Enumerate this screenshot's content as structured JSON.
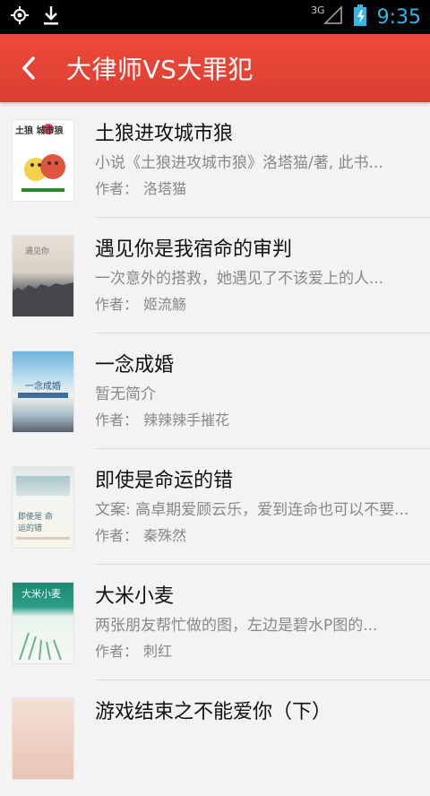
{
  "status": {
    "time": "9:35",
    "network": "3G"
  },
  "header": {
    "title": "大律师VS大罪犯"
  },
  "books": [
    {
      "title": "土狼进攻城市狼",
      "desc": "小说《土狼进攻城市狼》洛塔猫/著, 此书...",
      "author_label": "作者：",
      "author": "洛塔猫",
      "cover_text": "土狼 城市狼"
    },
    {
      "title": "遇见你是我宿命的审判",
      "desc": "一次意外的搭救，她遇见了不该爱上的人...",
      "author_label": "作者：",
      "author": "姬流觞",
      "cover_text": "遇见你"
    },
    {
      "title": "一念成婚",
      "desc": "暂无简介",
      "author_label": "作者：",
      "author": "辣辣辣手摧花",
      "cover_text": "一念成婚"
    },
    {
      "title": "即使是命运的错",
      "desc": "文案: 高卓期爱顾云乐，爱到连命也可以不要...",
      "author_label": "作者：",
      "author": "秦殊然",
      "cover_text": "即使是 命运的错"
    },
    {
      "title": "大米小麦",
      "desc": "两张朋友帮忙做的图，左边是碧水P图的...",
      "author_label": "作者：",
      "author": "刺红",
      "cover_text": "大米小麦"
    },
    {
      "title": "游戏结束之不能爱你（下）",
      "desc": "",
      "author_label": "",
      "author": "",
      "cover_text": ""
    }
  ]
}
